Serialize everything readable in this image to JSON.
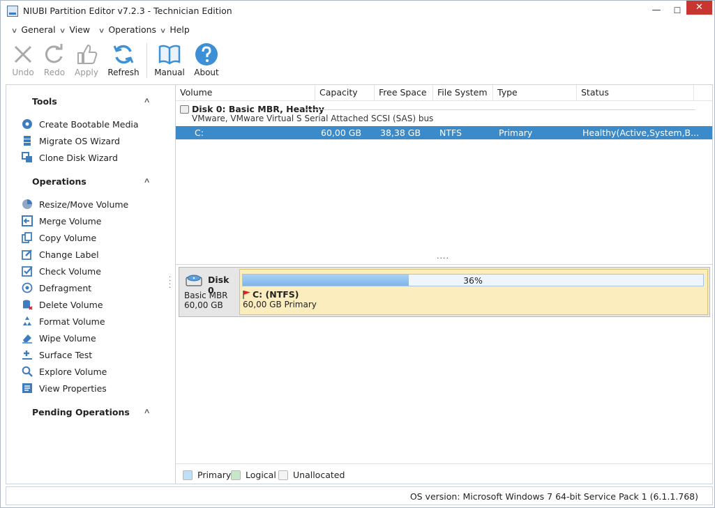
{
  "window": {
    "title": "NIUBI Partition Editor v7.2.3 - Technician Edition",
    "minimize_glyph": "—",
    "maximize_glyph": "☐",
    "close_glyph": "✕"
  },
  "menu": [
    {
      "label": "General"
    },
    {
      "label": "View"
    },
    {
      "label": "Operations"
    },
    {
      "label": "Help"
    }
  ],
  "toolbar": {
    "undo": "Undo",
    "redo": "Redo",
    "apply": "Apply",
    "refresh": "Refresh",
    "manual": "Manual",
    "about": "About"
  },
  "sidebar": {
    "tools_title": "Tools",
    "tools": [
      {
        "label": "Create Bootable Media",
        "icon": "bootable-media-icon"
      },
      {
        "label": "Migrate OS Wizard",
        "icon": "migrate-os-icon"
      },
      {
        "label": "Clone Disk Wizard",
        "icon": "clone-disk-icon"
      }
    ],
    "operations_title": "Operations",
    "operations": [
      {
        "label": "Resize/Move Volume",
        "icon": "resize-icon"
      },
      {
        "label": "Merge Volume",
        "icon": "merge-icon"
      },
      {
        "label": "Copy Volume",
        "icon": "copy-icon"
      },
      {
        "label": "Change Label",
        "icon": "label-icon"
      },
      {
        "label": "Check Volume",
        "icon": "check-icon"
      },
      {
        "label": "Defragment",
        "icon": "defragment-icon"
      },
      {
        "label": "Delete Volume",
        "icon": "delete-icon"
      },
      {
        "label": "Format Volume",
        "icon": "format-icon"
      },
      {
        "label": "Wipe Volume",
        "icon": "wipe-icon"
      },
      {
        "label": "Surface Test",
        "icon": "surface-test-icon"
      },
      {
        "label": "Explore Volume",
        "icon": "explore-icon"
      },
      {
        "label": "View Properties",
        "icon": "properties-icon"
      }
    ],
    "pending_title": "Pending Operations"
  },
  "grid": {
    "columns": [
      "Volume",
      "Capacity",
      "Free Space",
      "File System",
      "Type",
      "Status"
    ],
    "disk": {
      "title": "Disk 0: Basic MBR, Healthy",
      "subtitle": "VMware, VMware Virtual S Serial Attached SCSI (SAS) bus"
    },
    "rows": [
      {
        "volume": "C:",
        "capacity": "60,00 GB",
        "free": "38,38 GB",
        "fs": "NTFS",
        "type": "Primary",
        "status": "Healthy(Active,System,B..."
      }
    ]
  },
  "splitter": "....",
  "disk_map": {
    "name": "Disk 0",
    "type": "Basic MBR",
    "size": "60,00 GB",
    "partition": {
      "name": "C: (NTFS)",
      "desc": "60,00 GB Primary",
      "usage_label": "36%",
      "usage_fraction": 0.36
    }
  },
  "legend": [
    {
      "label": "Primary",
      "color": "#bfe0f7"
    },
    {
      "label": "Logical",
      "color": "#c9e6c9"
    },
    {
      "label": "Unallocated",
      "color": "#f4f4f4"
    }
  ],
  "status": {
    "os_version": "OS version: Microsoft Windows 7  64-bit Service Pack 1 (6.1.1.768)"
  },
  "colors": {
    "accent": "#3b8ac9",
    "toolbar_icon": "#3d8fd6",
    "close": "#c7372f",
    "partition_fill": "#fbedbd"
  }
}
